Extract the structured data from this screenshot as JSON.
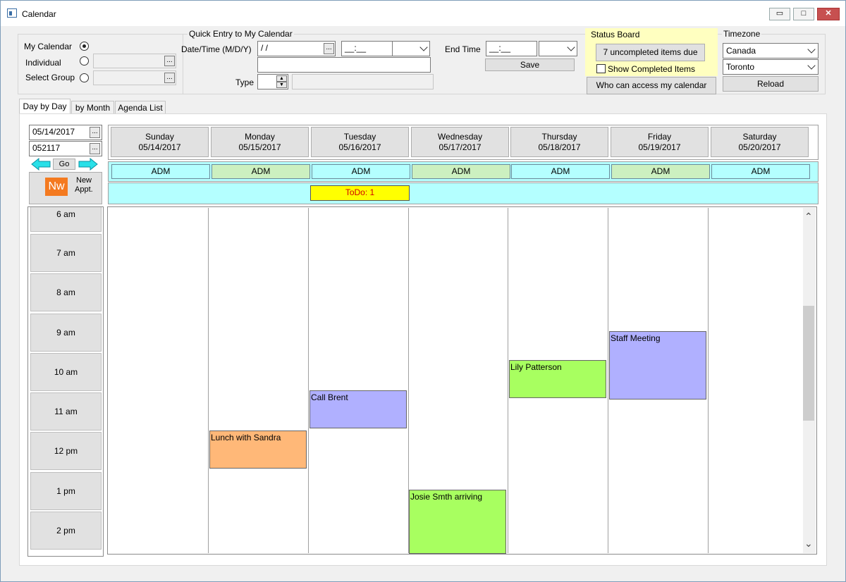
{
  "window": {
    "title": "Calendar",
    "minimize": "▭",
    "restore": "□",
    "close": "✕"
  },
  "calendar_select": {
    "my_calendar": "My Calendar",
    "individual": "Individual",
    "select_group": "Select Group",
    "ellipsis": "..."
  },
  "quick_entry": {
    "title": "Quick Entry to My Calendar",
    "datetime_label": "Date/Time (M/D/Y)",
    "date_value": " /  /",
    "time_value": "__:__",
    "type_label": "Type",
    "end_time_label": "End Time",
    "end_time_value": "__:__",
    "save": "Save"
  },
  "status_board": {
    "title": "Status Board",
    "uncompleted": "7 uncompleted items due",
    "show_completed": "Show Completed Items",
    "access": "Who can access my calendar",
    "bg_color": "#ffffc0"
  },
  "timezone": {
    "title": "Timezone",
    "country": "Canada",
    "city": "Toronto",
    "reload": "Reload"
  },
  "tabs": [
    "Day by Day",
    "by Month",
    "Agenda List"
  ],
  "nav": {
    "date": "05/14/2017",
    "code": "052117",
    "go": "Go",
    "new_icon": "Nw",
    "new_label_1": "New",
    "new_label_2": "Appt."
  },
  "days": [
    {
      "name": "Sunday",
      "date": "05/14/2017",
      "adm": "ADM",
      "adm_color": "#b4ffff"
    },
    {
      "name": "Monday",
      "date": "05/15/2017",
      "adm": "ADM",
      "adm_color": "#ccf0c0"
    },
    {
      "name": "Tuesday",
      "date": "05/16/2017",
      "adm": "ADM",
      "adm_color": "#b4ffff"
    },
    {
      "name": "Wednesday",
      "date": "05/17/2017",
      "adm": "ADM",
      "adm_color": "#ccf0c0"
    },
    {
      "name": "Thursday",
      "date": "05/18/2017",
      "adm": "ADM",
      "adm_color": "#b4ffff"
    },
    {
      "name": "Friday",
      "date": "05/19/2017",
      "adm": "ADM",
      "adm_color": "#ccf0c0"
    },
    {
      "name": "Saturday",
      "date": "05/20/2017",
      "adm": "ADM",
      "adm_color": "#b4ffff"
    }
  ],
  "todo": {
    "label": "ToDo: 1",
    "text_color": "#d00000",
    "bg_color": "#ffff00"
  },
  "times": [
    "6 am",
    "7 am",
    "8 am",
    "9 am",
    "10 am",
    "11 am",
    "12 pm",
    "1 pm",
    "2 pm"
  ],
  "appointments": [
    {
      "title": "Lunch with Sandra",
      "color": "#ffb878"
    },
    {
      "title": "Call Brent",
      "color": "#b0b0ff"
    },
    {
      "title": "Josie Smth arriving",
      "color": "#a8ff60"
    },
    {
      "title": "Lily Patterson",
      "color": "#a8ff60"
    },
    {
      "title": "Staff Meeting",
      "color": "#b0b0ff"
    }
  ],
  "scroll": {
    "up": "⌃",
    "down": "⌄"
  }
}
